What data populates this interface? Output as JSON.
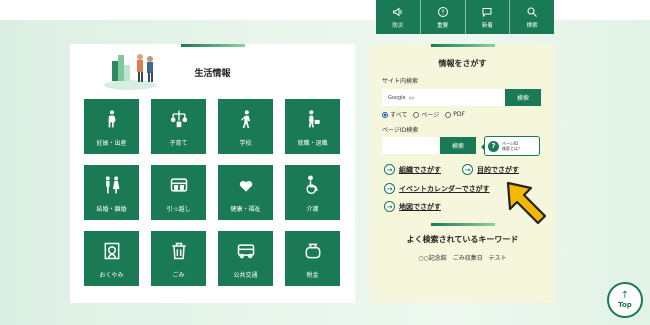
{
  "topnav": {
    "items": [
      {
        "label": "防災",
        "icon": "megaphone-icon"
      },
      {
        "label": "重要",
        "icon": "alert-icon"
      },
      {
        "label": "新着",
        "icon": "chat-icon"
      },
      {
        "label": "検索",
        "icon": "search-icon"
      }
    ]
  },
  "life": {
    "title": "生活情報",
    "tiles": [
      {
        "label": "妊娠・出産",
        "icon": "pregnancy-icon"
      },
      {
        "label": "子育て",
        "icon": "mobile-toy-icon"
      },
      {
        "label": "学校",
        "icon": "student-icon"
      },
      {
        "label": "就職・退職",
        "icon": "businessperson-icon"
      },
      {
        "label": "結婚・離婚",
        "icon": "couple-icon"
      },
      {
        "label": "引っ越し",
        "icon": "moving-truck-icon"
      },
      {
        "label": "健康・福祉",
        "icon": "heart-hands-icon"
      },
      {
        "label": "介護",
        "icon": "wheelchair-icon"
      },
      {
        "label": "おくやみ",
        "icon": "memorial-icon"
      },
      {
        "label": "ごみ",
        "icon": "trash-icon"
      },
      {
        "label": "公共交通",
        "icon": "bus-icon"
      },
      {
        "label": "税金",
        "icon": "wallet-icon"
      }
    ]
  },
  "search": {
    "title": "情報をさがす",
    "site_label": "サイト内検索",
    "google_text": "Google",
    "google_sub": "提供",
    "button": "検索",
    "radios": [
      {
        "label": "すべて",
        "selected": true
      },
      {
        "label": "ページ",
        "selected": false
      },
      {
        "label": "PDF",
        "selected": false
      }
    ],
    "page_id_label": "ページID検索",
    "page_id_button": "検索",
    "help_line1": "ページID",
    "help_line2": "検索とは？",
    "links": [
      "組織でさがす",
      "目的でさがす",
      "イベントカレンダーでさがす",
      "地図でさがす"
    ]
  },
  "keywords": {
    "title": "よく検索されているキーワード",
    "items": [
      "○○記念館",
      "ごみ収集日",
      "テスト"
    ]
  },
  "top_button": {
    "label": "Top",
    "arrow": "↑"
  },
  "colors": {
    "primary": "#1a7a55",
    "panel_bg": "#f6f6dc",
    "pointer": "#f5b800"
  }
}
